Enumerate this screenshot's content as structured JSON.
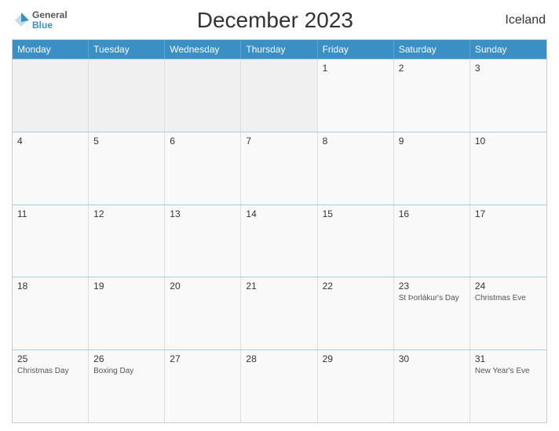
{
  "header": {
    "title": "December 2023",
    "country": "Iceland",
    "logo_general": "General",
    "logo_blue": "Blue"
  },
  "dayHeaders": [
    "Monday",
    "Tuesday",
    "Wednesday",
    "Thursday",
    "Friday",
    "Saturday",
    "Sunday"
  ],
  "weeks": [
    [
      {
        "date": "",
        "event": "",
        "empty": true
      },
      {
        "date": "",
        "event": "",
        "empty": true
      },
      {
        "date": "",
        "event": "",
        "empty": true
      },
      {
        "date": "",
        "event": "",
        "empty": true
      },
      {
        "date": "1",
        "event": ""
      },
      {
        "date": "2",
        "event": ""
      },
      {
        "date": "3",
        "event": ""
      }
    ],
    [
      {
        "date": "4",
        "event": ""
      },
      {
        "date": "5",
        "event": ""
      },
      {
        "date": "6",
        "event": ""
      },
      {
        "date": "7",
        "event": ""
      },
      {
        "date": "8",
        "event": ""
      },
      {
        "date": "9",
        "event": ""
      },
      {
        "date": "10",
        "event": ""
      }
    ],
    [
      {
        "date": "11",
        "event": ""
      },
      {
        "date": "12",
        "event": ""
      },
      {
        "date": "13",
        "event": ""
      },
      {
        "date": "14",
        "event": ""
      },
      {
        "date": "15",
        "event": ""
      },
      {
        "date": "16",
        "event": ""
      },
      {
        "date": "17",
        "event": ""
      }
    ],
    [
      {
        "date": "18",
        "event": ""
      },
      {
        "date": "19",
        "event": ""
      },
      {
        "date": "20",
        "event": ""
      },
      {
        "date": "21",
        "event": ""
      },
      {
        "date": "22",
        "event": ""
      },
      {
        "date": "23",
        "event": "St Þorlákur's Day"
      },
      {
        "date": "24",
        "event": "Christmas Eve"
      }
    ],
    [
      {
        "date": "25",
        "event": "Christmas Day"
      },
      {
        "date": "26",
        "event": "Boxing Day"
      },
      {
        "date": "27",
        "event": ""
      },
      {
        "date": "28",
        "event": ""
      },
      {
        "date": "29",
        "event": ""
      },
      {
        "date": "30",
        "event": ""
      },
      {
        "date": "31",
        "event": "New Year's Eve"
      }
    ]
  ]
}
